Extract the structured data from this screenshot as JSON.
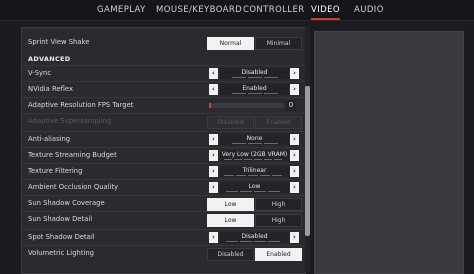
{
  "tabs": [
    {
      "label": "GAMEPLAY"
    },
    {
      "label": "MOUSE/KEYBOARD"
    },
    {
      "label": "CONTROLLER"
    },
    {
      "label": "VIDEO"
    },
    {
      "label": "AUDIO"
    }
  ],
  "active_tab": "VIDEO",
  "accent": "#d43a2e",
  "settings": {
    "sprint_view_shake": {
      "label": "Sprint View Shake",
      "options": [
        "Normal",
        "Minimal"
      ],
      "selected": "Normal"
    },
    "advanced_heading": "ADVANCED",
    "vsync": {
      "label": "V-Sync",
      "value": "Disabled"
    },
    "nvidia_reflex": {
      "label": "NVidia Reflex",
      "value": "Enabled"
    },
    "adaptive_fps": {
      "label": "Adaptive Resolution FPS Target",
      "value": "0"
    },
    "adaptive_supersampling": {
      "label": "Adaptive Supersampling",
      "options": [
        "Disabled",
        "Enabled"
      ]
    },
    "anti_aliasing": {
      "label": "Anti-aliasing",
      "value": "None"
    },
    "texture_streaming": {
      "label": "Texture Streaming Budget",
      "value": "Very Low (2GB VRAM)"
    },
    "texture_filtering": {
      "label": "Texture Filtering",
      "value": "Trilinear"
    },
    "ambient_occlusion": {
      "label": "Ambient Occlusion Quality",
      "value": "Low"
    },
    "sun_shadow_coverage": {
      "label": "Sun Shadow Coverage",
      "options": [
        "Low",
        "High"
      ],
      "selected": "Low"
    },
    "sun_shadow_detail": {
      "label": "Sun Shadow Detail",
      "options": [
        "Low",
        "High"
      ],
      "selected": "Low"
    },
    "spot_shadow_detail": {
      "label": "Spot Shadow Detail",
      "value": "Disabled"
    },
    "volumetric_lighting": {
      "label": "Volumetric Lighting",
      "options": [
        "Disabled",
        "Enabled"
      ],
      "selected": "Enabled"
    }
  }
}
